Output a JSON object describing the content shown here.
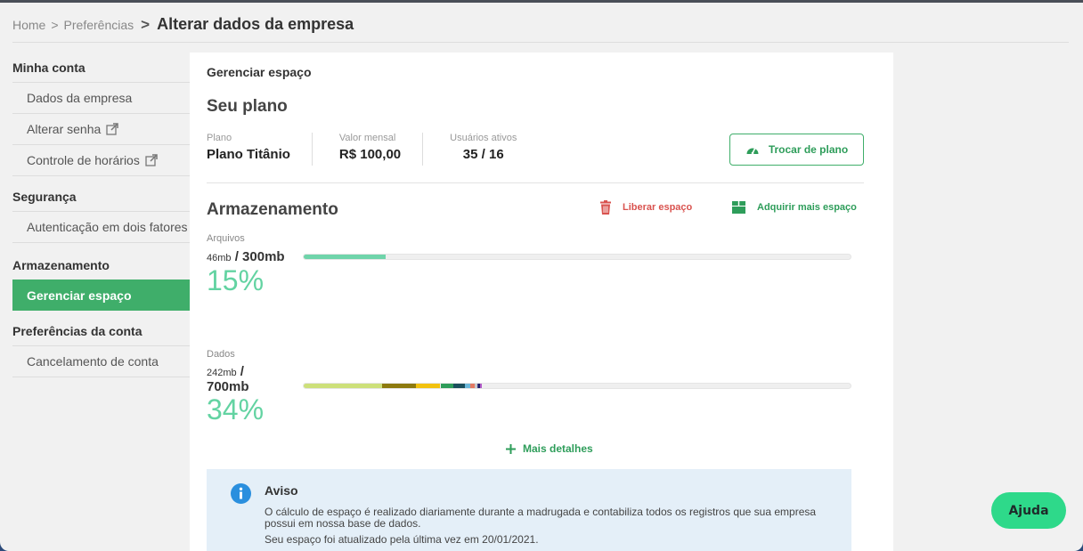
{
  "breadcrumb": {
    "home": "Home",
    "separator": ">",
    "parent": "Preferências",
    "current_separator": ">",
    "current": "Alterar dados da empresa"
  },
  "sidebar": {
    "sections": [
      {
        "heading": "Minha conta",
        "items": [
          {
            "label": "Dados da empresa",
            "external": false,
            "active": false
          },
          {
            "label": "Alterar senha",
            "external": true,
            "active": false
          },
          {
            "label": "Controle de horários",
            "external": true,
            "active": false
          }
        ]
      },
      {
        "heading": "Segurança",
        "items": [
          {
            "label": "Autenticação em dois fatores",
            "external": false,
            "active": false
          }
        ]
      },
      {
        "heading": "Armazenamento",
        "items": [
          {
            "label": "Gerenciar espaço",
            "external": false,
            "active": true
          }
        ]
      },
      {
        "heading": "Preferências da conta",
        "items": [
          {
            "label": "Cancelamento de conta",
            "external": false,
            "active": false
          }
        ]
      }
    ]
  },
  "card": {
    "title": "Gerenciar espaço",
    "plan_title": "Seu plano",
    "plan": {
      "plan_label": "Plano",
      "plan_value": "Plano Titânio",
      "price_label": "Valor mensal",
      "price_value": "R$ 100,00",
      "users_label": "Usuários ativos",
      "users_value": "35 / 16"
    },
    "change_plan_button": "Trocar de plano",
    "storage_title": "Armazenamento",
    "free_space_label": "Liberar espaço",
    "buy_space_label": "Adquirir mais espaço",
    "files": {
      "label": "Arquivos",
      "used": "46mb",
      "slash": " / ",
      "total": "300mb",
      "percent_text": "15%",
      "fill_fraction": 0.15
    },
    "data": {
      "label": "Dados",
      "used": "242mb",
      "slash": " /",
      "total": "700mb",
      "percent_text": "34%",
      "segments": [
        {
          "fraction": 0.143,
          "color": "#cde07a"
        },
        {
          "fraction": 0.062,
          "color": "#8d7a0f"
        },
        {
          "fraction": 0.045,
          "color": "#f2c20f"
        },
        {
          "fraction": 0.023,
          "color": "#2e9d5a"
        },
        {
          "fraction": 0.022,
          "color": "#1a4f5c"
        },
        {
          "fraction": 0.01,
          "color": "#6bb7d9"
        },
        {
          "fraction": 0.007,
          "color": "#e37a63"
        },
        {
          "fraction": 0.005,
          "color": "#c9c9c9"
        },
        {
          "fraction": 0.003,
          "color": "#3a3a8f"
        },
        {
          "fraction": 0.003,
          "color": "#222266"
        },
        {
          "fraction": 0.003,
          "color": "#b35cc9"
        }
      ]
    },
    "more_details": "Mais detalhes",
    "notice": {
      "title": "Aviso",
      "text": "O cálculo de espaço é realizado diariamente durante a madrugada e contabiliza todos os registros que sua empresa possui em nossa base de dados.",
      "updated": "Seu espaço foi atualizado pela última vez em 20/01/2021."
    }
  },
  "help_button": "Ajuda",
  "colors": {
    "accent_green": "#3fae6a",
    "percent_green": "#63d3a2",
    "danger_red": "#d9534f",
    "help_green": "#2ed98a",
    "notice_bg": "#e4eff8"
  },
  "icons": {
    "external": "external-link-icon",
    "speedometer": "speedometer-icon",
    "trash": "trash-icon",
    "box": "box-icon",
    "plus": "plus-icon",
    "info": "info-icon"
  }
}
